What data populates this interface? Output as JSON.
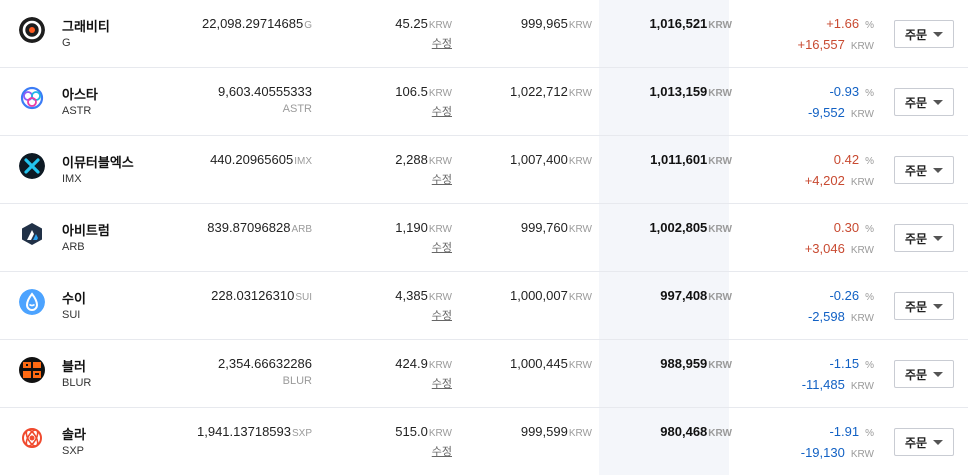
{
  "unit_krw": "KRW",
  "unit_pct": "%",
  "edit_label": "수정",
  "order_label": "주문",
  "rows": [
    {
      "name": "그래비티",
      "symbol": "G",
      "qty": "22,098.29714685",
      "qty_unit": "G",
      "qty_symbol": "",
      "avg_price": "45.25",
      "buy_amount": "999,965",
      "eval_amount": "1,016,521",
      "rate": "+1.66",
      "gain": "+16,557",
      "direction": "up",
      "icon": "gravity-icon"
    },
    {
      "name": "아스타",
      "symbol": "ASTR",
      "qty": "9,603.40555333",
      "qty_unit": "",
      "qty_symbol": "ASTR",
      "avg_price": "106.5",
      "buy_amount": "1,022,712",
      "eval_amount": "1,013,159",
      "rate": "-0.93",
      "gain": "-9,552",
      "direction": "down",
      "icon": "astar-icon"
    },
    {
      "name": "이뮤터블엑스",
      "symbol": "IMX",
      "qty": "440.20965605",
      "qty_unit": "IMX",
      "qty_symbol": "",
      "avg_price": "2,288",
      "buy_amount": "1,007,400",
      "eval_amount": "1,011,601",
      "rate": "0.42",
      "gain": "+4,202",
      "direction": "up",
      "icon": "immutable-x-icon"
    },
    {
      "name": "아비트럼",
      "symbol": "ARB",
      "qty": "839.87096828",
      "qty_unit": "ARB",
      "qty_symbol": "",
      "avg_price": "1,190",
      "buy_amount": "999,760",
      "eval_amount": "1,002,805",
      "rate": "0.30",
      "gain": "+3,046",
      "direction": "up",
      "icon": "arbitrum-icon"
    },
    {
      "name": "수이",
      "symbol": "SUI",
      "qty": "228.03126310",
      "qty_unit": "SUI",
      "qty_symbol": "",
      "avg_price": "4,385",
      "buy_amount": "1,000,007",
      "eval_amount": "997,408",
      "rate": "-0.26",
      "gain": "-2,598",
      "direction": "down",
      "icon": "sui-icon"
    },
    {
      "name": "블러",
      "symbol": "BLUR",
      "qty": "2,354.66632286",
      "qty_unit": "",
      "qty_symbol": "BLUR",
      "avg_price": "424.9",
      "buy_amount": "1,000,445",
      "eval_amount": "988,959",
      "rate": "-1.15",
      "gain": "-11,485",
      "direction": "down",
      "icon": "blur-icon"
    },
    {
      "name": "솔라",
      "symbol": "SXP",
      "qty": "1,941.13718593",
      "qty_unit": "SXP",
      "qty_symbol": "",
      "avg_price": "515.0",
      "buy_amount": "999,599",
      "eval_amount": "980,468",
      "rate": "-1.91",
      "gain": "-19,130",
      "direction": "down",
      "icon": "solar-icon"
    }
  ],
  "colors": {
    "up": "#c84a31",
    "down": "#1261c4",
    "eval_bg": "#f4f6fa",
    "divider": "#e7e9ee"
  }
}
